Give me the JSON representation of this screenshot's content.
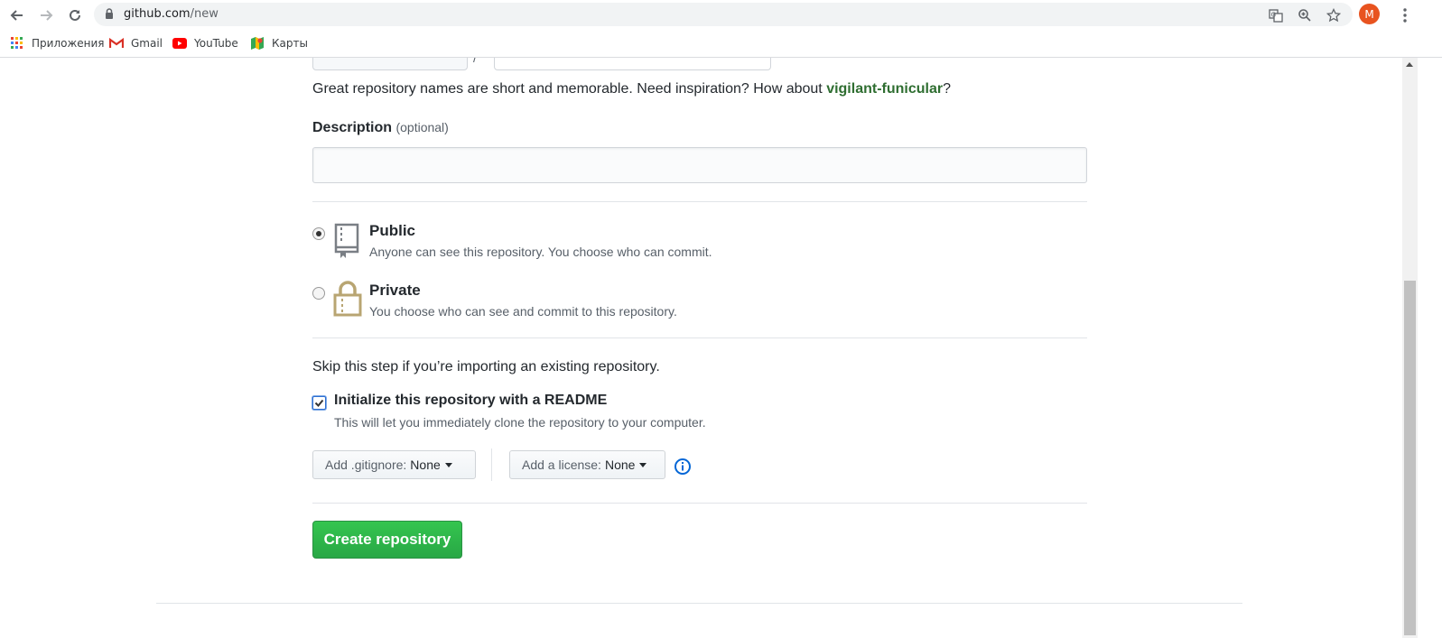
{
  "browser": {
    "url_host": "github.com",
    "url_path": "/new",
    "profile_initial": "M",
    "bookmarks": [
      {
        "label": "Приложения",
        "icon": "apps-grid-icon"
      },
      {
        "label": "Gmail",
        "icon": "gmail-icon"
      },
      {
        "label": "YouTube",
        "icon": "youtube-icon"
      },
      {
        "label": "Карты",
        "icon": "maps-icon"
      }
    ]
  },
  "form": {
    "name_hint_prefix": "Great repository names are short and memorable. Need inspiration? How about ",
    "name_suggestion": "vigilant-funicular",
    "name_hint_suffix": "?",
    "description_label": "Description",
    "description_optional": "(optional)",
    "description_value": "",
    "visibility": {
      "selected": "public",
      "public_title": "Public",
      "public_note": "Anyone can see this repository. You choose who can commit.",
      "private_title": "Private",
      "private_note": "You choose who can see and commit to this repository."
    },
    "skip_text": "Skip this step if you’re importing an existing repository.",
    "readme": {
      "checked": true,
      "title": "Initialize this repository with a README",
      "note": "This will let you immediately clone the repository to your computer."
    },
    "gitignore_label": "Add .gitignore:",
    "gitignore_value": "None",
    "license_label": "Add a license:",
    "license_value": "None",
    "create_button": "Create repository"
  },
  "colors": {
    "accent_green": "#28a745",
    "suggestion_green": "#2f6e31",
    "info_blue": "#0366d6",
    "avatar_orange": "#e8531f"
  }
}
